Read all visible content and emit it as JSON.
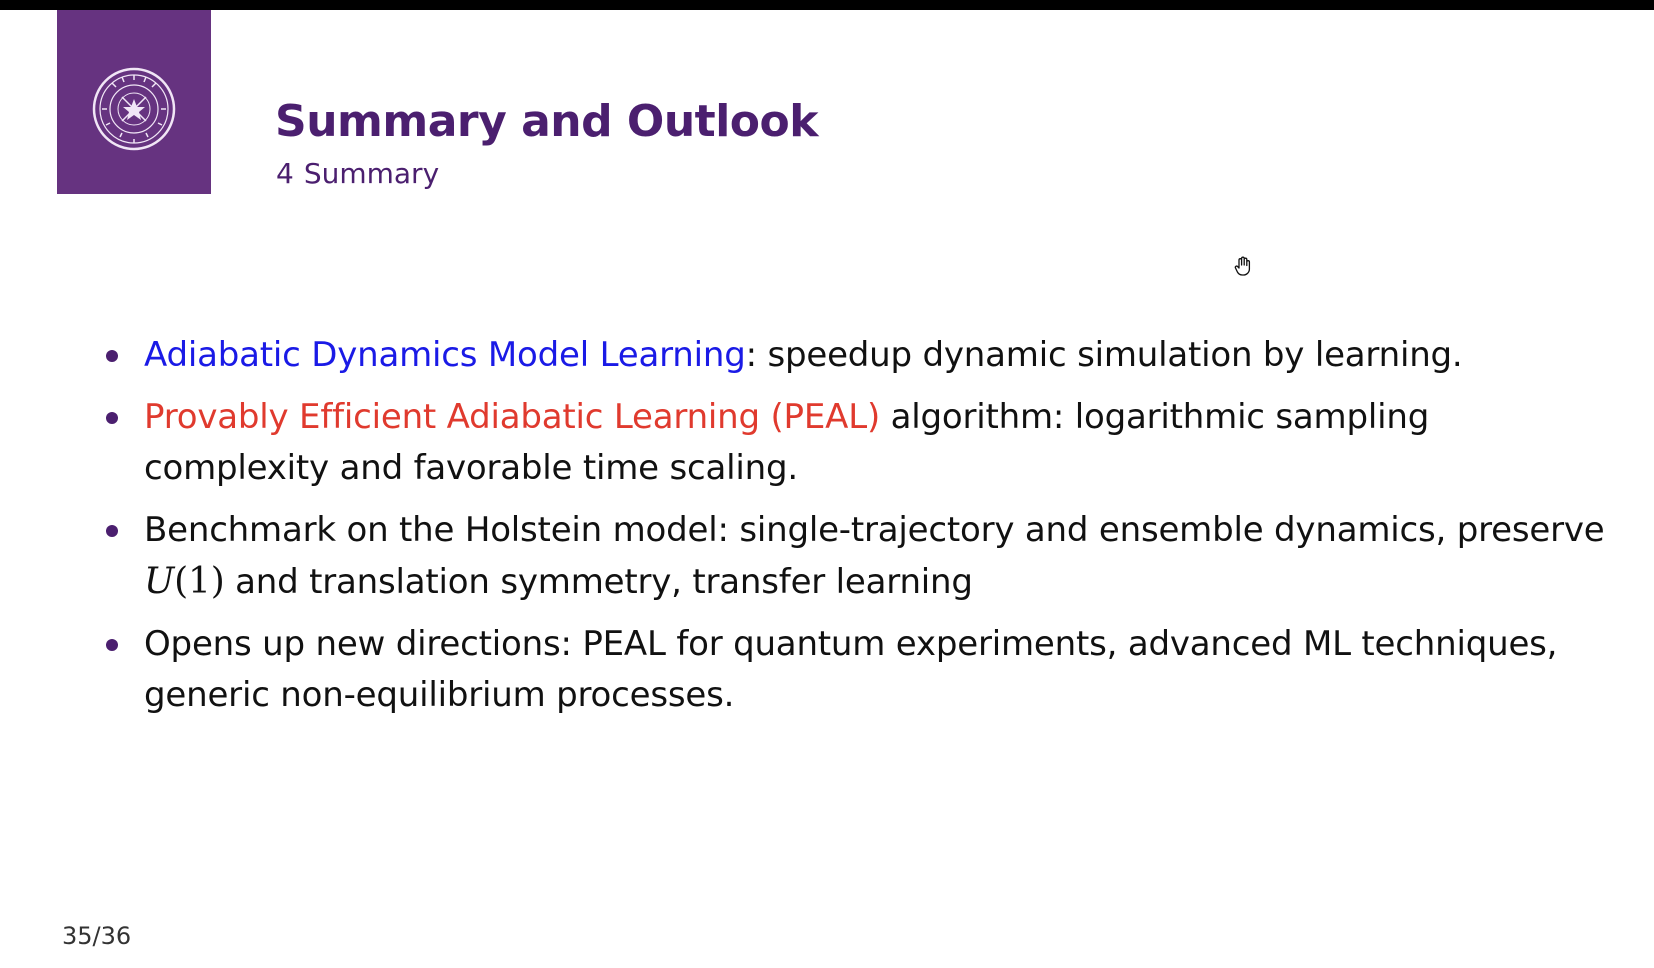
{
  "slide": {
    "title": "Summary and Outlook",
    "section_number": "4",
    "section_name": "Summary",
    "page": "35/36"
  },
  "bullets": [
    {
      "highlight": "Adiabatic Dynamics Model Learning",
      "highlight_color": "#1a1ae6",
      "rest": ": speedup dynamic simulation by learning."
    },
    {
      "highlight": "Provably Efficient Adiabatic Learning (PEAL)",
      "highlight_color": "#e03a2e",
      "rest": " algorithm: logarithmic sampling complexity and favorable time scaling."
    },
    {
      "before": "Benchmark on the Holstein model: single-trajectory and ensemble dynamics, preserve ",
      "math_var": "U",
      "math_arg": "(1)",
      "after": " and translation symmetry, transfer learning"
    },
    {
      "text": "Opens up new directions: PEAL for quantum experiments, advanced ML techniques, generic non-equilibrium processes."
    }
  ],
  "colors": {
    "brand_purple": "#663380",
    "title_purple": "#4b1f6f"
  },
  "icons": {
    "logo": "university-seal-icon",
    "cursor": "hand-cursor-icon"
  }
}
